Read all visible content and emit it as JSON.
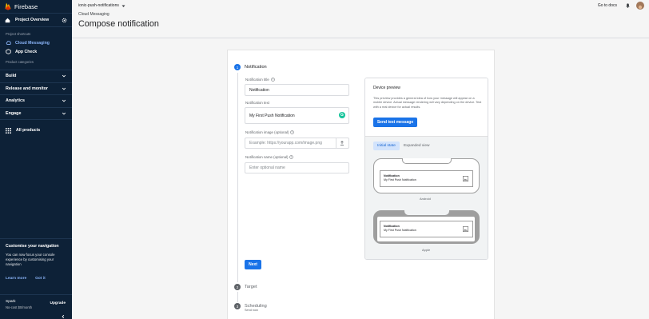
{
  "sidebar": {
    "brand": "Firebase",
    "project_overview": "Project Overview",
    "section_shortcuts": "Project shortcuts",
    "shortcuts": [
      {
        "label": "Cloud Messaging",
        "icon": "cloud-messaging-icon",
        "active": true
      },
      {
        "label": "App Check",
        "icon": "app-check-icon",
        "active": false
      }
    ],
    "section_categories": "Product categories",
    "categories": [
      "Build",
      "Release and monitor",
      "Analytics",
      "Engage"
    ],
    "all_products": "All products",
    "promo": {
      "title": "Customise your navigation",
      "desc": "You can now focus your console experience by customising your navigation",
      "learn_more": "Learn more",
      "got_it": "Got it"
    },
    "plan": {
      "name": "Spark",
      "cost": "No-cost $0/month",
      "upgrade": "Upgrade"
    }
  },
  "header": {
    "project": "ionic-push-notifications",
    "breadcrumb": "Cloud Messaging",
    "title": "Compose notification",
    "docs": "Go to docs"
  },
  "form": {
    "steps": [
      {
        "num": "1",
        "label": "Notification"
      },
      {
        "num": "2",
        "label": "Target"
      },
      {
        "num": "3",
        "label": "Scheduling",
        "sub": "Send now"
      }
    ],
    "title_label": "Notification title",
    "title_value": "Notification",
    "text_label": "Notification text",
    "text_value": "My First Push Notification",
    "image_label": "Notification image (optional)",
    "image_placeholder": "Example: https://yourapp.com/image.png",
    "name_label": "Notification name (optional)",
    "name_placeholder": "Enter optional name",
    "next": "Next"
  },
  "preview": {
    "title": "Device preview",
    "desc": "This preview provides a general idea of how your message will appear on a mobile device. Actual message rendering will vary depending on the device. Test with a real device for actual results.",
    "send_test": "Send test message",
    "tabs": [
      "Initial state",
      "Expanded view"
    ],
    "notif_title": "Notification",
    "notif_text": "My First Push Notification",
    "android_label": "Android",
    "apple_label": "Apple"
  },
  "colors": {
    "sidebar": "#0d2137",
    "accent": "#1a73e8",
    "active": "#8ab4f8"
  }
}
